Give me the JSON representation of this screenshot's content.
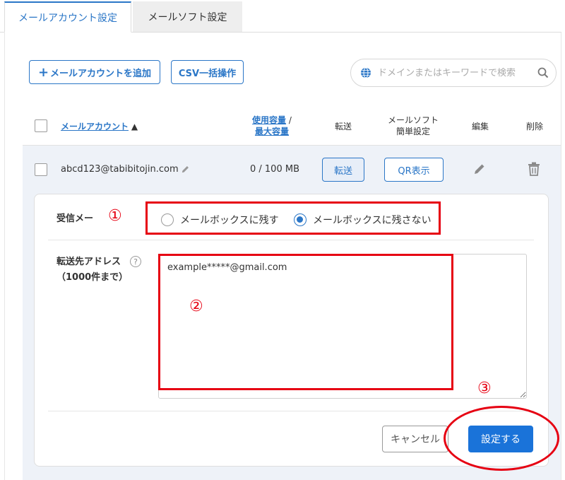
{
  "tabs": [
    {
      "label": "メールアカウント設定",
      "active": true
    },
    {
      "label": "メールソフト設定",
      "active": false
    }
  ],
  "toolbar": {
    "add_plus": "+",
    "add_label": "メールアカウントを追加",
    "csv_label": "CSV一括操作",
    "search_placeholder": "ドメインまたはキーワードで検索"
  },
  "table": {
    "headers": {
      "account": "メールアカウント",
      "sort_indicator": "▲",
      "usage": "使用容量",
      "usage_sep": "/",
      "max": "最大容量",
      "forward": "転送",
      "mailsoft_line1": "メールソフト",
      "mailsoft_line2": "簡単設定",
      "edit": "編集",
      "delete": "削除"
    },
    "rows": [
      {
        "account": "abcd123@tabibitojin.com",
        "usage": "0 / 100 MB",
        "forward_button": "転送",
        "qr_button": "QR表示"
      }
    ]
  },
  "forward_panel": {
    "receive_label": "受信メー",
    "receive_options": [
      {
        "label": "メールボックスに残す",
        "selected": false
      },
      {
        "label": "メールボックスに残さない",
        "selected": true
      }
    ],
    "address_label": "転送先アドレス",
    "address_sublabel": "（1000件まで）",
    "help_glyph": "?",
    "address_value": "example*****@gmail.com",
    "cancel_button": "キャンセル",
    "submit_button": "設定する"
  },
  "annotations": {
    "marker_1": "①",
    "marker_2": "②",
    "marker_3": "③",
    "color": "#e60012"
  },
  "colors": {
    "accent": "#2a76c7",
    "primary_button": "#1a73d9",
    "row_highlight": "#eef2f8"
  },
  "icons": [
    "globe-icon",
    "search-icon",
    "sort-up-icon",
    "pencil-icon",
    "edit-icon",
    "trash-icon",
    "help-icon"
  ]
}
